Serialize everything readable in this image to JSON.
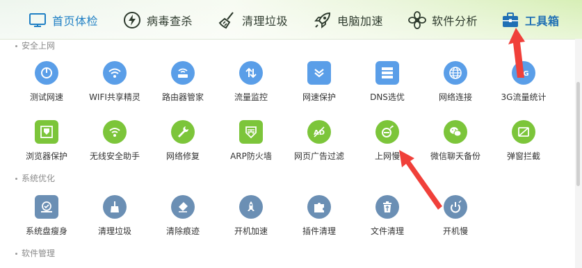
{
  "nav": {
    "tabs": [
      {
        "label": "首页体检",
        "icon": "monitor-icon"
      },
      {
        "label": "病毒查杀",
        "icon": "lightning-icon"
      },
      {
        "label": "清理垃圾",
        "icon": "broom-icon"
      },
      {
        "label": "电脑加速",
        "icon": "rocket-icon"
      },
      {
        "label": "软件分析",
        "icon": "fan-icon"
      },
      {
        "label": "工具箱",
        "icon": "toolbox-icon"
      }
    ]
  },
  "sections": {
    "net": "安全上网",
    "sys": "系统优化",
    "soft": "软件管理"
  },
  "net_row1": [
    {
      "label": "测试网速"
    },
    {
      "label": "WIFI共享精灵"
    },
    {
      "label": "路由器管家"
    },
    {
      "label": "流量监控"
    },
    {
      "label": "网速保护"
    },
    {
      "label": "DNS选优"
    },
    {
      "label": "网络连接"
    },
    {
      "label": "3G流量统计",
      "icon_text": "3G"
    }
  ],
  "net_row2": [
    {
      "label": "浏览器保护"
    },
    {
      "label": "无线安全助手"
    },
    {
      "label": "网络修复"
    },
    {
      "label": "ARP防火墙"
    },
    {
      "label": "网页广告过滤",
      "icon_text": "AD"
    },
    {
      "label": "上网慢"
    },
    {
      "label": "微信聊天备份"
    },
    {
      "label": "弹窗拦截"
    }
  ],
  "sys_row": [
    {
      "label": "系统盘瘦身"
    },
    {
      "label": "清理垃圾"
    },
    {
      "label": "清除痕迹"
    },
    {
      "label": "开机加速"
    },
    {
      "label": "插件清理"
    },
    {
      "label": "文件清理"
    },
    {
      "label": "开机慢"
    }
  ],
  "colors": {
    "blue": "#5a9ee8",
    "green": "#7cc53a",
    "steel": "#6b8fb4",
    "arrow": "#f0403a",
    "active_tab": "#1f7fc4"
  }
}
